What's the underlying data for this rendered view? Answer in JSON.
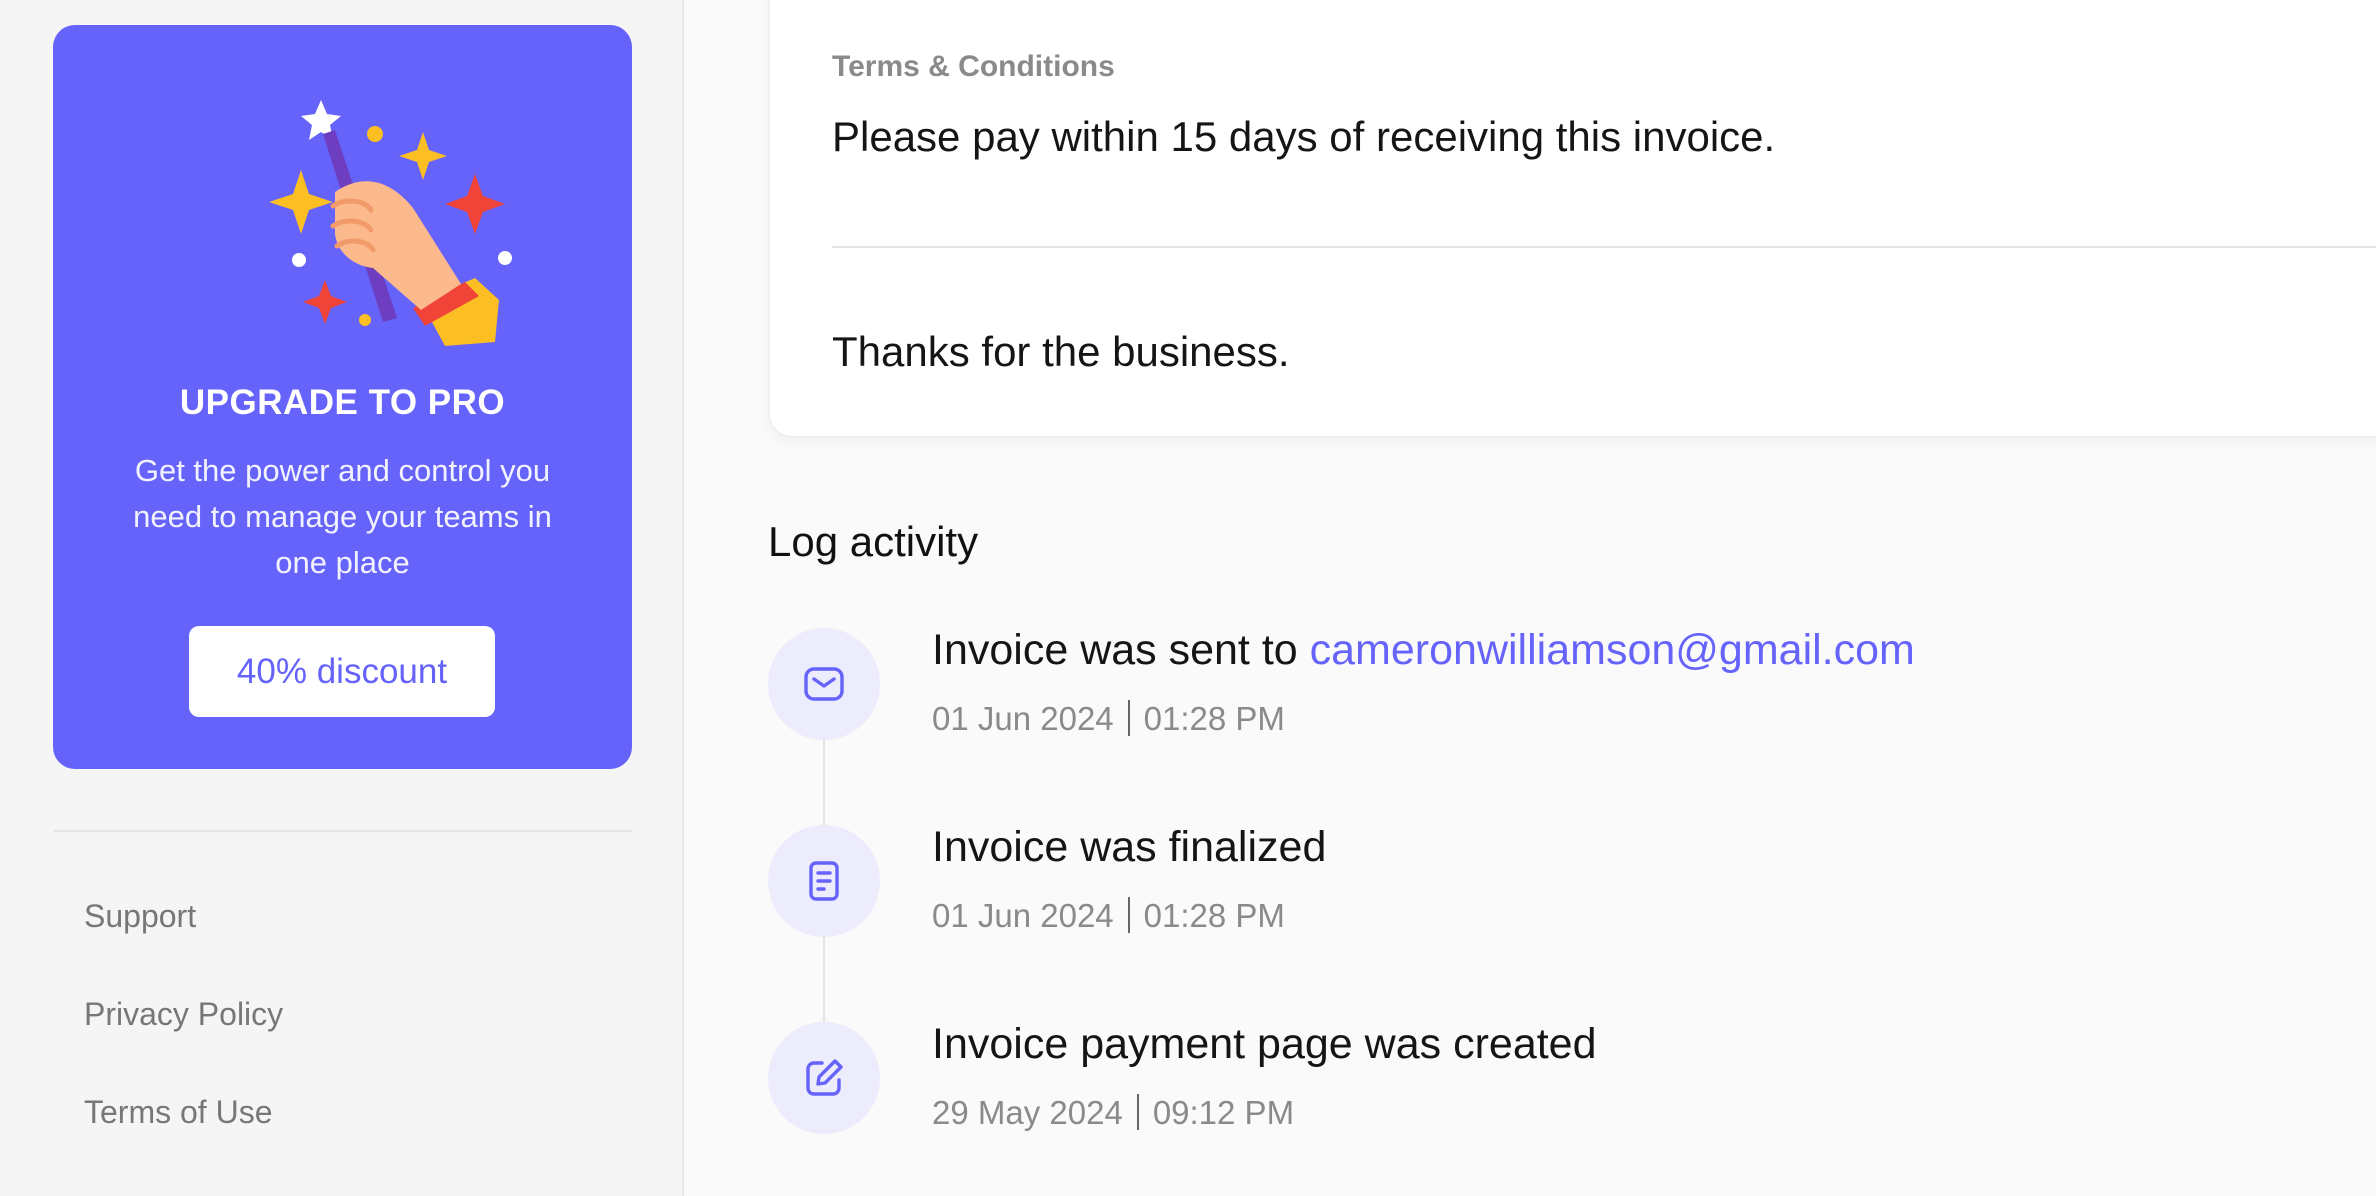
{
  "promo": {
    "title": "UPGRADE TO PRO",
    "description": "Get the power and control you need to manage your teams in one place",
    "button_label": "40% discount"
  },
  "sidebar_links": [
    "Support",
    "Privacy Policy",
    "Terms of Use"
  ],
  "invoice": {
    "terms_label": "Terms & Conditions",
    "terms_text": "Please pay within 15 days of receiving this invoice.",
    "thanks_text": "Thanks for the business."
  },
  "log": {
    "title": "Log activity",
    "items": [
      {
        "icon": "mail-icon",
        "text": "Invoice was sent to ",
        "link": "cameronwilliamson@gmail.com",
        "date": "01 Jun 2024",
        "time": "01:28 PM"
      },
      {
        "icon": "document-icon",
        "text": "Invoice was finalized",
        "date": "01 Jun 2024",
        "time": "01:28 PM"
      },
      {
        "icon": "edit-icon",
        "text": "Invoice payment page was created",
        "date": "29 May 2024",
        "time": "09:12 PM"
      }
    ]
  },
  "colors": {
    "accent": "#6663fb",
    "accent_light": "#ececfd"
  }
}
